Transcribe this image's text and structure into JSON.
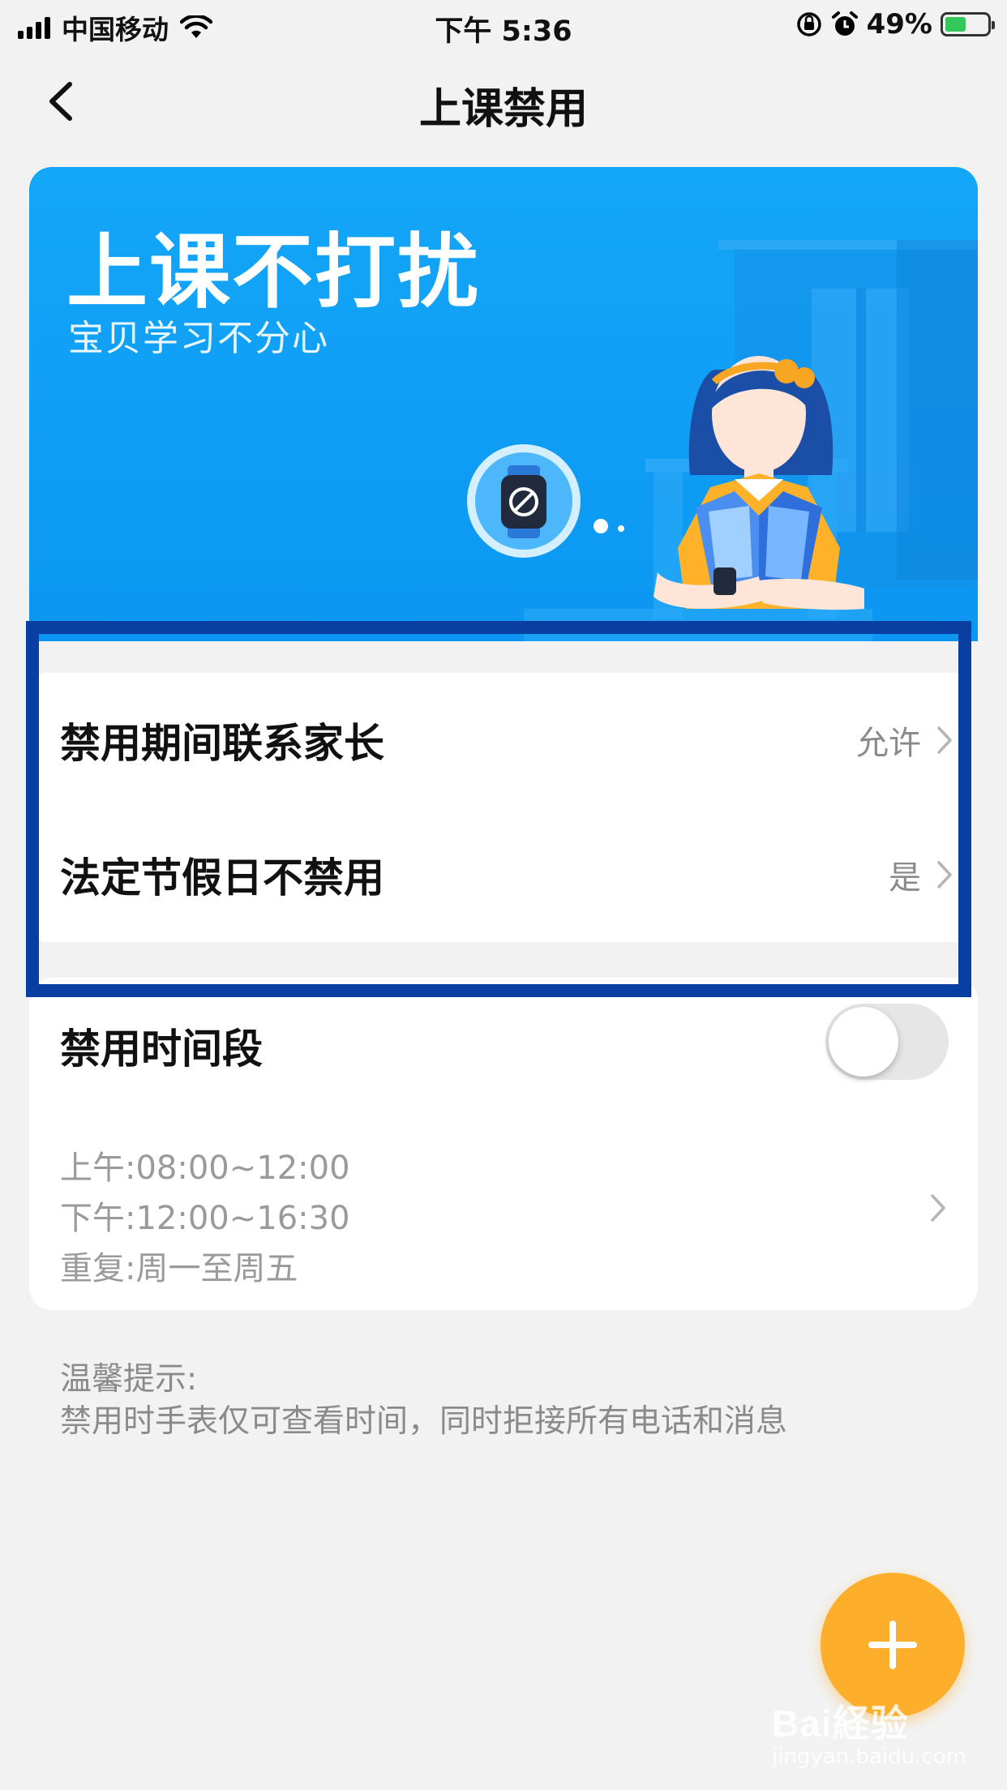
{
  "status_bar": {
    "carrier": "中国移动",
    "time": "下午 5:36",
    "battery_percent": "49%",
    "battery_level": 0.49,
    "icons": [
      "signal-icon",
      "wifi-icon",
      "orientation-lock-icon",
      "alarm-icon",
      "battery-icon"
    ]
  },
  "nav": {
    "title": "上课禁用",
    "back_icon": "chevron-left-icon"
  },
  "banner": {
    "title": "上课不打扰",
    "subtitle": "宝贝学习不分心"
  },
  "settings": [
    {
      "label": "禁用期间联系家长",
      "value": "允许"
    },
    {
      "label": "法定节假日不禁用",
      "value": "是"
    }
  ],
  "period": {
    "title": "禁用时间段",
    "toggle_on": false,
    "morning": "上午:08:00~12:00",
    "afternoon": "下午:12:00~16:30",
    "repeat": "重复:周一至周五"
  },
  "tip": {
    "title": "温馨提示:",
    "text": "禁用时手表仅可查看时间，同时拒接所有电话和消息"
  },
  "fab": {
    "icon": "plus-icon"
  },
  "watermark": {
    "logo": "Bai経验",
    "url": "jingyan.baidu.com"
  },
  "colors": {
    "banner_blue": "#0b97f1",
    "highlight_border": "#0a3fa2",
    "fab_orange": "#fdae2a"
  }
}
